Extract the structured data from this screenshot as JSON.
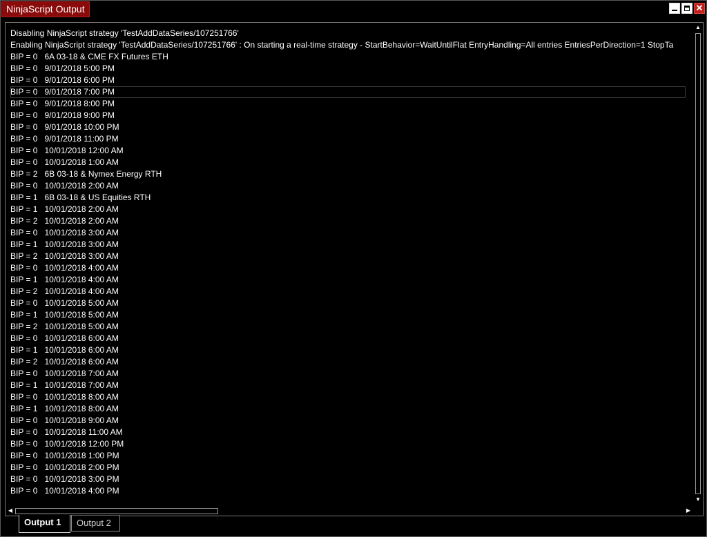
{
  "window": {
    "title": "NinjaScript Output",
    "close_glyph": "✕"
  },
  "log_lines": [
    "Disabling NinjaScript strategy 'TestAddDataSeries/107251766'",
    "Enabling NinjaScript strategy 'TestAddDataSeries/107251766' : On starting a real-time strategy - StartBehavior=WaitUntilFlat EntryHandling=All entries EntriesPerDirection=1 StopTa",
    "BIP = 0   6A 03-18 & CME FX Futures ETH",
    "BIP = 0   9/01/2018 5:00 PM",
    "BIP = 0   9/01/2018 6:00 PM",
    "BIP = 0   9/01/2018 7:00 PM",
    "BIP = 0   9/01/2018 8:00 PM",
    "BIP = 0   9/01/2018 9:00 PM",
    "BIP = 0   9/01/2018 10:00 PM",
    "BIP = 0   9/01/2018 11:00 PM",
    "BIP = 0   10/01/2018 12:00 AM",
    "BIP = 0   10/01/2018 1:00 AM",
    "BIP = 2   6B 03-18 & Nymex Energy RTH",
    "BIP = 0   10/01/2018 2:00 AM",
    "BIP = 1   6B 03-18 & US Equities RTH",
    "BIP = 1   10/01/2018 2:00 AM",
    "BIP = 2   10/01/2018 2:00 AM",
    "BIP = 0   10/01/2018 3:00 AM",
    "BIP = 1   10/01/2018 3:00 AM",
    "BIP = 2   10/01/2018 3:00 AM",
    "BIP = 0   10/01/2018 4:00 AM",
    "BIP = 1   10/01/2018 4:00 AM",
    "BIP = 2   10/01/2018 4:00 AM",
    "BIP = 0   10/01/2018 5:00 AM",
    "BIP = 1   10/01/2018 5:00 AM",
    "BIP = 2   10/01/2018 5:00 AM",
    "BIP = 0   10/01/2018 6:00 AM",
    "BIP = 1   10/01/2018 6:00 AM",
    "BIP = 2   10/01/2018 6:00 AM",
    "BIP = 0   10/01/2018 7:00 AM",
    "BIP = 1   10/01/2018 7:00 AM",
    "BIP = 0   10/01/2018 8:00 AM",
    "BIP = 1   10/01/2018 8:00 AM",
    "BIP = 0   10/01/2018 9:00 AM",
    "BIP = 0   10/01/2018 11:00 AM",
    "BIP = 0   10/01/2018 12:00 PM",
    "BIP = 0   10/01/2018 1:00 PM",
    "BIP = 0   10/01/2018 2:00 PM",
    "BIP = 0   10/01/2018 3:00 PM",
    "BIP = 0   10/01/2018 4:00 PM"
  ],
  "selected_line_index": 5,
  "tabs": [
    {
      "label": "Output 1",
      "active": true
    },
    {
      "label": "Output 2",
      "active": false
    }
  ],
  "scroll": {
    "up_glyph": "▲",
    "down_glyph": "▼",
    "left_glyph": "◀",
    "right_glyph": "▶"
  },
  "colors": {
    "title_tab": "#8b0a0a",
    "close_button": "#c0201a",
    "background": "#000000",
    "text": "#ffffff"
  }
}
